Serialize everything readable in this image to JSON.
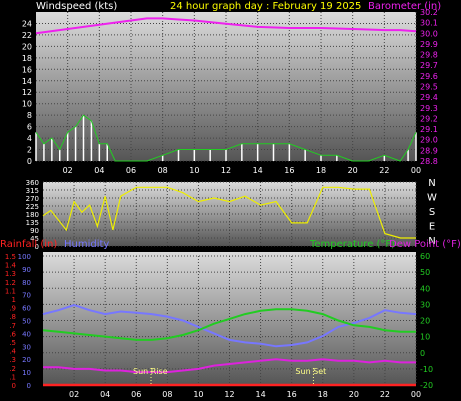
{
  "header": {
    "left_label": "Windspeed (kts)",
    "title": "24 hour graph day : February 19 2025",
    "right_label": "Barometer (in)"
  },
  "colors": {
    "background": "#000000",
    "plot_top": "#dcdcdc",
    "plot_bottom": "#555555",
    "grid": "#444444",
    "wind_gust": "#ffffff",
    "wind_avg": "#22cc22",
    "barometer": "#ee22ee",
    "direction": "#eeee00",
    "rainfall": "#ff2222",
    "humidity": "#7777ff",
    "temperature": "#22cc22",
    "dew_point": "#dd22dd",
    "axis_text": "#ffffff"
  },
  "x_axis": {
    "ticks": [
      "02",
      "04",
      "06",
      "08",
      "10",
      "12",
      "14",
      "16",
      "18",
      "20",
      "22",
      "00"
    ]
  },
  "sun": {
    "rise_label": "Sun Rise",
    "rise_hour": 6.95,
    "set_label": "Sun Set",
    "set_hour": 17.4
  },
  "compass": [
    "N",
    "W",
    "S",
    "E",
    "N"
  ],
  "chart_data": [
    {
      "type": "line",
      "title": "24 hour graph day : February 19 2025",
      "x_range": [
        0,
        24
      ],
      "axes": {
        "left": {
          "label": "Windspeed (kts)",
          "ylim": [
            0,
            26
          ],
          "ticks": [
            0,
            2,
            4,
            6,
            8,
            10,
            12,
            14,
            16,
            18,
            20,
            22,
            24
          ]
        },
        "right": {
          "label": "Barometer (in)",
          "ylim": [
            28.8,
            30.2
          ],
          "ticks": [
            28.8,
            28.9,
            29.0,
            29.1,
            29.2,
            29.3,
            29.4,
            29.5,
            29.6,
            29.7,
            29.8,
            29.9,
            30.0,
            30.1,
            30.2
          ]
        }
      },
      "series": [
        {
          "name": "Windspeed (kts)",
          "axis": "left",
          "x": [
            0,
            0.5,
            1,
            1.5,
            2,
            2.5,
            3,
            3.5,
            4,
            4.5,
            5,
            6,
            7,
            8,
            9,
            10,
            11,
            12,
            13,
            14,
            15,
            16,
            17,
            18,
            19,
            20,
            21,
            22,
            23,
            23.5,
            24
          ],
          "y": [
            5,
            3,
            4,
            2,
            5,
            6,
            8,
            7,
            3,
            3,
            0,
            0,
            0,
            1,
            2,
            2,
            2,
            2,
            3,
            3,
            3,
            3,
            2,
            1,
            1,
            0,
            0,
            1,
            0,
            2,
            5
          ]
        },
        {
          "name": "Barometer (in)",
          "axis": "right",
          "x": [
            0,
            2,
            4,
            6,
            7,
            8,
            9,
            10,
            12,
            14,
            16,
            18,
            20,
            22,
            23,
            24
          ],
          "y": [
            30.0,
            30.04,
            30.08,
            30.12,
            30.14,
            30.14,
            30.13,
            30.12,
            30.09,
            30.06,
            30.05,
            30.05,
            30.04,
            30.03,
            30.03,
            30.02
          ]
        }
      ]
    },
    {
      "type": "line",
      "x_range": [
        0,
        24
      ],
      "axes": {
        "left": {
          "ylim": [
            0,
            360
          ],
          "ticks": [
            0,
            45,
            90,
            135,
            180,
            225,
            270,
            315,
            360
          ]
        }
      },
      "series": [
        {
          "name": "Wind direction",
          "x": [
            0,
            0.5,
            1.5,
            2,
            2.5,
            3,
            3.5,
            4,
            4.5,
            5,
            6,
            7,
            8,
            9,
            10,
            11,
            12,
            13,
            14,
            15,
            16,
            17,
            18,
            19,
            20,
            21,
            22,
            23,
            24
          ],
          "y": [
            170,
            200,
            90,
            250,
            190,
            230,
            110,
            280,
            90,
            280,
            330,
            330,
            330,
            300,
            250,
            270,
            250,
            280,
            230,
            250,
            130,
            130,
            330,
            330,
            320,
            320,
            70,
            45,
            45
          ]
        }
      ]
    },
    {
      "type": "line",
      "x_range": [
        0,
        24
      ],
      "axes": {
        "left_outer": {
          "label": "Rainfall (in)",
          "ylim": [
            0,
            1.5
          ],
          "ticks": [
            0,
            0.1,
            0.2,
            0.3,
            0.4,
            0.5,
            0.6,
            0.7,
            0.8,
            0.9,
            1,
            1.1,
            1.2,
            1.3,
            1.4,
            1.5
          ]
        },
        "left_inner": {
          "label": "Humidity",
          "ylim": [
            0,
            100
          ],
          "ticks": [
            0,
            10,
            20,
            30,
            40,
            50,
            60,
            70,
            80,
            90,
            100
          ]
        },
        "right": {
          "label": "Temperature (°F)",
          "ylim": [
            -20,
            60
          ],
          "ticks": [
            -20,
            -10,
            0,
            10,
            20,
            30,
            40,
            50,
            60
          ]
        }
      },
      "series": [
        {
          "name": "Rainfall (in)",
          "axis": "left_outer",
          "x": [
            0,
            24
          ],
          "y": [
            0,
            0
          ]
        },
        {
          "name": "Humidity",
          "axis": "left_inner",
          "x": [
            0,
            1,
            2,
            3,
            4,
            5,
            6,
            7,
            8,
            9,
            10,
            11,
            12,
            13,
            14,
            15,
            16,
            17,
            18,
            19,
            20,
            21,
            22,
            23,
            24
          ],
          "y": [
            55,
            58,
            62,
            58,
            55,
            57,
            56,
            55,
            53,
            50,
            45,
            40,
            35,
            33,
            32,
            30,
            31,
            33,
            38,
            45,
            48,
            52,
            58,
            56,
            55
          ]
        },
        {
          "name": "Temperature (°F)",
          "axis": "right",
          "x": [
            0,
            1,
            2,
            3,
            4,
            5,
            6,
            7,
            8,
            9,
            10,
            11,
            12,
            13,
            14,
            15,
            16,
            17,
            18,
            19,
            20,
            21,
            22,
            23,
            24
          ],
          "y": [
            14,
            13,
            12,
            11,
            10,
            9,
            8,
            8,
            9,
            11,
            14,
            18,
            21,
            24,
            26,
            27,
            27,
            26,
            24,
            20,
            17,
            16,
            14,
            13,
            13
          ]
        },
        {
          "name": "Dew Point (°F)",
          "axis": "right",
          "x": [
            0,
            1,
            2,
            3,
            4,
            5,
            6,
            7,
            8,
            9,
            10,
            11,
            12,
            13,
            14,
            15,
            16,
            17,
            18,
            19,
            20,
            21,
            22,
            23,
            24
          ],
          "y": [
            -9,
            -9,
            -10,
            -10,
            -11,
            -11,
            -12,
            -12,
            -12,
            -11,
            -10,
            -8,
            -7,
            -6,
            -5,
            -4,
            -5,
            -5,
            -4,
            -5,
            -5,
            -6,
            -5,
            -6,
            -6
          ]
        }
      ]
    }
  ]
}
